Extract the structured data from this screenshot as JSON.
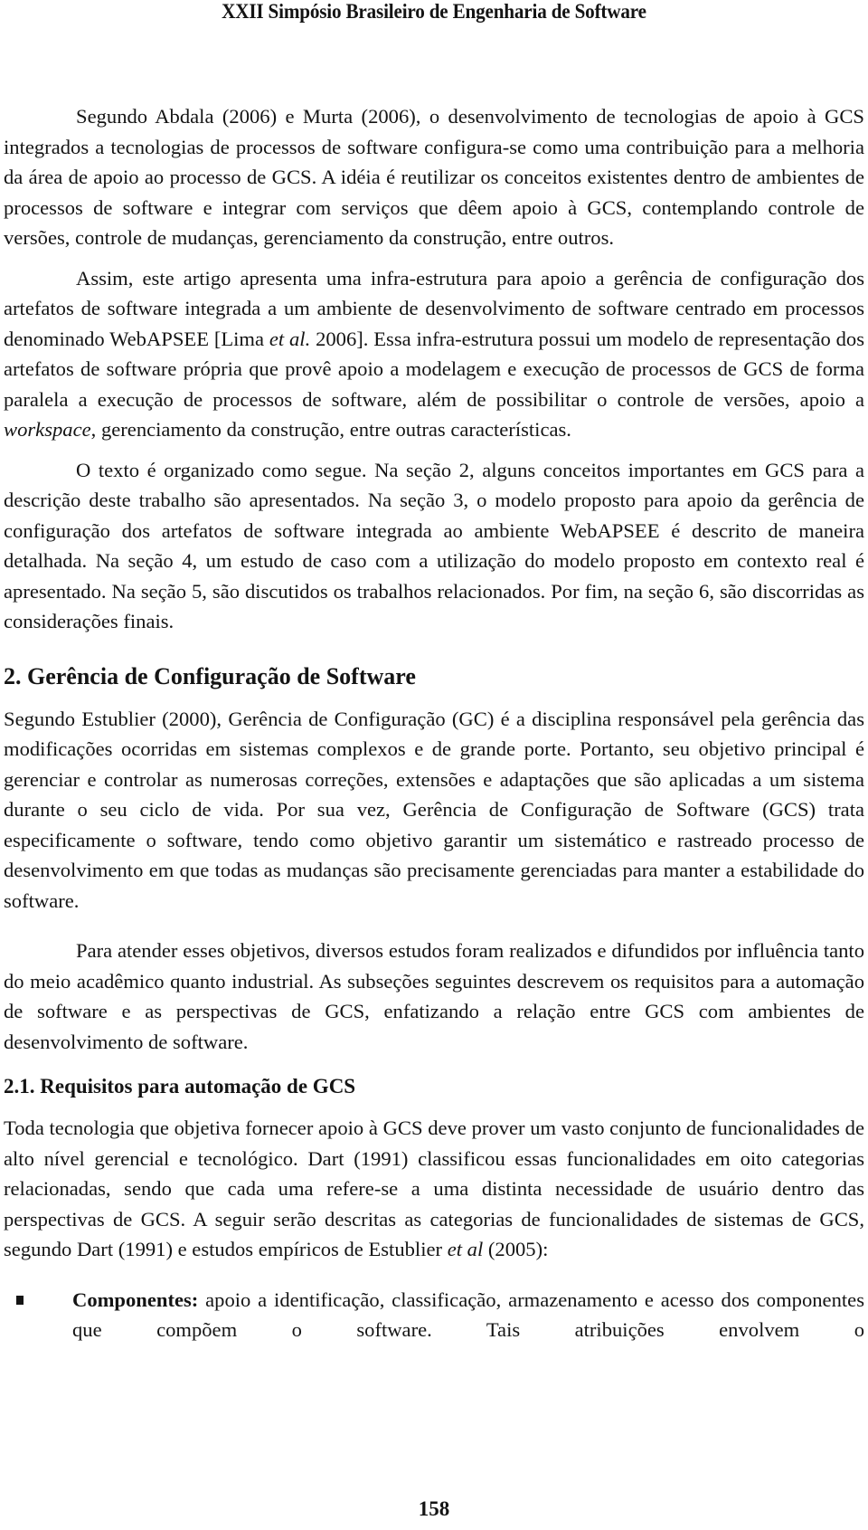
{
  "header": {
    "conference": "XXII Simpósio Brasileiro de Engenharia de Software"
  },
  "intro": {
    "p1": "Segundo Abdala (2006) e Murta (2006), o desenvolvimento de tecnologias de apoio à GCS integrados a tecnologias de processos de software configura-se como uma contribuição para a melhoria da área de apoio ao processo de GCS. A idéia é reutilizar os conceitos existentes dentro de ambientes de processos de software e integrar com serviços que dêem apoio à GCS, contemplando controle de versões, controle de mudanças, gerenciamento da construção, entre outros.",
    "p2": {
      "part1": "Assim, este artigo apresenta uma infra-estrutura para apoio a gerência de configuração dos artefatos de software integrada a um ambiente de desenvolvimento de software centrado em processos denominado WebAPSEE [Lima ",
      "italic1": "et al.",
      "part2": " 2006]. Essa infra-estrutura possui um modelo de representação dos artefatos de software própria que provê apoio a modelagem e execução de processos de GCS de forma paralela a execução de processos de software, além de possibilitar o controle de versões, apoio a ",
      "italic2": "workspace",
      "part3": ", gerenciamento da construção, entre outras características."
    },
    "p3": "O texto é organizado como segue. Na seção 2, alguns conceitos importantes em GCS para a descrição deste trabalho são apresentados. Na seção 3, o modelo proposto para apoio da gerência de configuração dos artefatos de software integrada ao ambiente WebAPSEE é descrito de maneira detalhada. Na seção 4, um estudo de caso com a utilização do modelo proposto em contexto real é apresentado. Na seção 5, são discutidos os trabalhos relacionados. Por fim, na seção 6, são discorridas as considerações finais."
  },
  "section2": {
    "heading": "2. Gerência de Configuração de Software",
    "p1": "Segundo Estublier (2000), Gerência de Configuração (GC) é a disciplina responsável pela gerência das modificações ocorridas em sistemas complexos e de grande porte. Portanto, seu objetivo principal é gerenciar e controlar as numerosas correções, extensões e adaptações que são aplicadas a um sistema durante o seu ciclo de vida. Por sua vez, Gerência de Configuração de Software (GCS) trata especificamente o software, tendo como objetivo garantir um sistemático e rastreado processo de desenvolvimento em que todas as mudanças são precisamente gerenciadas para manter a estabilidade do software.",
    "p2": "Para atender esses objetivos, diversos estudos foram realizados e difundidos por influência tanto do meio acadêmico quanto industrial. As subseções seguintes descrevem os requisitos para a automação de software e as perspectivas de GCS, enfatizando a relação entre GCS com ambientes de desenvolvimento de software."
  },
  "section2_1": {
    "heading": "2.1. Requisitos para automação de GCS",
    "p1": {
      "part1": "Toda tecnologia que objetiva fornecer apoio à GCS deve prover um vasto conjunto de funcionalidades de alto nível gerencial e tecnológico. Dart (1991) classificou essas funcionalidades em oito categorias relacionadas, sendo que cada uma refere-se a uma distinta necessidade de usuário dentro das perspectivas de GCS. A seguir serão descritas as categorias de funcionalidades de sistemas de GCS, segundo Dart (1991) e estudos empíricos de Estublier ",
      "italic": "et al",
      "part2": " (2005):"
    },
    "bullets": [
      {
        "term": "Componentes:",
        "text": " apoio a identificação, classificação, armazenamento e acesso dos componentes que compõem o software. Tais atribuições envolvem o"
      }
    ]
  },
  "footer": {
    "page_number": "158"
  }
}
